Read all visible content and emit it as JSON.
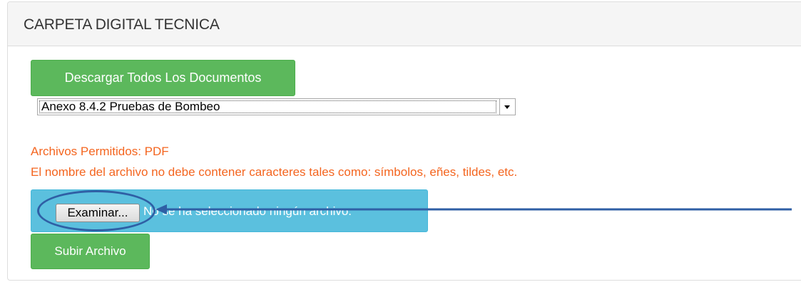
{
  "panel": {
    "title": "CARPETA DIGITAL TECNICA"
  },
  "actions": {
    "download_all_label": "Descargar Todos Los Documentos",
    "upload_label": "Subir Archivo"
  },
  "document_select": {
    "selected": "Anexo 8.4.2 Pruebas de Bombeo"
  },
  "notes": {
    "allowed_files": "Archivos Permitidos: PDF",
    "filename_rule": "El nombre del archivo no debe contener caracteres tales como: símbolos, eñes, tildes, etc."
  },
  "file_input": {
    "browse_label": "Examinar...",
    "status_text": "No se ha seleccionado ningún archivo."
  },
  "colors": {
    "success": "#5cb85c",
    "info": "#5bc0de",
    "warning_text": "#f4651f",
    "annotation": "#2f5fa5"
  }
}
